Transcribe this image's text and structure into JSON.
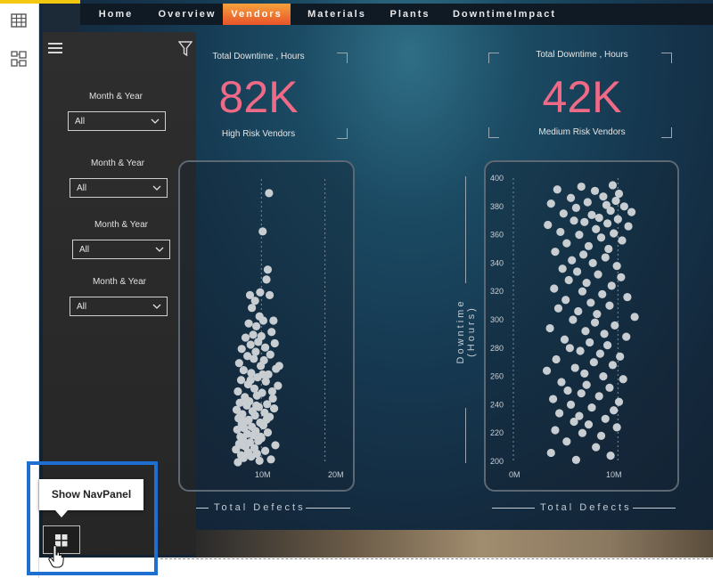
{
  "nav": {
    "tabs": [
      {
        "label": "Home",
        "active": false
      },
      {
        "label": "Overview",
        "active": false
      },
      {
        "label": "Vendors",
        "active": true
      },
      {
        "label": "Materials",
        "active": false
      },
      {
        "label": "Plants",
        "active": false
      },
      {
        "label": "DowntimeImpact",
        "active": false
      }
    ]
  },
  "filters": {
    "slicers": [
      {
        "label": "Month & Year",
        "value": "All"
      },
      {
        "label": "Month & Year",
        "value": "All"
      },
      {
        "label": "Month & Year",
        "value": "All"
      },
      {
        "label": "Month & Year",
        "value": "All"
      }
    ]
  },
  "kpis": {
    "high": {
      "title": "Total Downtime , Hours",
      "value": "82K",
      "caption": "High Risk Vendors"
    },
    "medium": {
      "title": "Total Downtime , Hours",
      "value": "42K",
      "caption": "Medium Risk Vendors"
    }
  },
  "tooltip": {
    "text": "Show NavPanel"
  },
  "colors": {
    "accent": "#ef6a86",
    "highlight": "#1f6fd0",
    "dot": "#c8cdd2"
  },
  "chart_data": [
    {
      "type": "scatter",
      "xlabel": "Total Defects",
      "ylabel": "",
      "x_ticks": [
        "10M",
        "20M"
      ],
      "y_ticks": [],
      "xlim": [
        0,
        23
      ],
      "ylim": [
        200,
        400
      ],
      "points": [
        [
          11.2,
          390
        ],
        [
          10.2,
          363
        ],
        [
          11.0,
          336
        ],
        [
          10.8,
          329
        ],
        [
          9.8,
          320
        ],
        [
          11.3,
          318
        ],
        [
          8.2,
          318
        ],
        [
          9.0,
          314
        ],
        [
          8.5,
          309
        ],
        [
          9.7,
          303
        ],
        [
          10.3,
          300
        ],
        [
          11.9,
          300
        ],
        [
          8.0,
          298
        ],
        [
          9.2,
          296
        ],
        [
          11.6,
          292
        ],
        [
          8.7,
          290
        ],
        [
          10.0,
          289
        ],
        [
          7.5,
          288
        ],
        [
          9.5,
          285
        ],
        [
          12.1,
          284
        ],
        [
          8.3,
          283
        ],
        [
          10.6,
          281
        ],
        [
          6.9,
          280
        ],
        [
          9.1,
          278
        ],
        [
          11.4,
          276
        ],
        [
          7.8,
          275
        ],
        [
          8.8,
          273
        ],
        [
          10.4,
          272
        ],
        [
          6.5,
          270
        ],
        [
          9.9,
          268
        ],
        [
          12.3,
          266
        ],
        [
          7.2,
          265
        ],
        [
          8.4,
          263
        ],
        [
          11.1,
          262
        ],
        [
          9.4,
          260
        ],
        [
          6.8,
          258
        ],
        [
          10.7,
          257
        ],
        [
          7.9,
          255
        ],
        [
          12.6,
          254
        ],
        [
          8.9,
          252
        ],
        [
          6.3,
          250
        ],
        [
          10.1,
          249
        ],
        [
          9.3,
          247
        ],
        [
          7.4,
          246
        ],
        [
          11.8,
          245
        ],
        [
          8.1,
          243
        ],
        [
          6.6,
          242
        ],
        [
          10.9,
          241
        ],
        [
          7.7,
          240
        ],
        [
          9.6,
          239
        ],
        [
          12.0,
          238
        ],
        [
          6.1,
          237
        ],
        [
          8.6,
          236
        ],
        [
          10.5,
          235
        ],
        [
          7.0,
          234
        ],
        [
          9.0,
          233
        ],
        [
          11.3,
          232
        ],
        [
          6.4,
          231
        ],
        [
          8.0,
          230
        ],
        [
          7.6,
          229
        ],
        [
          9.8,
          228
        ],
        [
          6.9,
          227
        ],
        [
          10.3,
          226
        ],
        [
          8.5,
          225
        ],
        [
          7.3,
          224
        ],
        [
          6.2,
          223
        ],
        [
          9.1,
          222
        ],
        [
          11.0,
          221
        ],
        [
          7.8,
          220
        ],
        [
          8.7,
          219
        ],
        [
          6.7,
          218
        ],
        [
          10.0,
          217
        ],
        [
          7.1,
          216
        ],
        [
          9.5,
          215
        ],
        [
          8.2,
          214
        ],
        [
          6.5,
          213
        ],
        [
          12.2,
          212
        ],
        [
          7.5,
          211
        ],
        [
          8.9,
          210
        ],
        [
          6.0,
          209
        ],
        [
          10.6,
          208
        ],
        [
          7.9,
          207
        ],
        [
          9.3,
          206
        ],
        [
          6.8,
          205
        ],
        [
          8.4,
          204
        ],
        [
          7.2,
          203
        ],
        [
          11.5,
          202
        ],
        [
          9.7,
          201
        ],
        [
          6.3,
          200
        ],
        [
          8.0,
          206
        ],
        [
          7.0,
          212
        ],
        [
          9.9,
          218
        ],
        [
          10.8,
          230
        ],
        [
          11.7,
          250
        ],
        [
          12.8,
          268
        ],
        [
          8.3,
          258
        ],
        [
          7.4,
          244
        ],
        [
          6.6,
          232
        ],
        [
          9.2,
          240
        ],
        [
          10.2,
          262
        ]
      ]
    },
    {
      "type": "scatter",
      "xlabel": "Total Defects",
      "ylabel": "Downtime (Hours)",
      "x_ticks": [
        "0M",
        "10M"
      ],
      "y_ticks": [
        200,
        220,
        240,
        260,
        280,
        300,
        320,
        340,
        360,
        380,
        400
      ],
      "xlim": [
        0,
        15
      ],
      "ylim": [
        200,
        400
      ],
      "points": [
        [
          4.2,
          392
        ],
        [
          6.5,
          394
        ],
        [
          9.5,
          395
        ],
        [
          7.8,
          391
        ],
        [
          10.1,
          389
        ],
        [
          8.6,
          387
        ],
        [
          5.5,
          386
        ],
        [
          9.8,
          384
        ],
        [
          7.1,
          383
        ],
        [
          3.6,
          382
        ],
        [
          8.9,
          381
        ],
        [
          10.6,
          380
        ],
        [
          6.0,
          379
        ],
        [
          9.3,
          377
        ],
        [
          11.3,
          376
        ],
        [
          4.8,
          375
        ],
        [
          7.5,
          374
        ],
        [
          8.2,
          372
        ],
        [
          10.0,
          371
        ],
        [
          5.8,
          370
        ],
        [
          6.8,
          369
        ],
        [
          9.0,
          368
        ],
        [
          3.3,
          367
        ],
        [
          11.0,
          366
        ],
        [
          7.9,
          364
        ],
        [
          4.5,
          362
        ],
        [
          9.6,
          361
        ],
        [
          6.3,
          360
        ],
        [
          8.4,
          358
        ],
        [
          10.4,
          356
        ],
        [
          5.1,
          354
        ],
        [
          7.2,
          352
        ],
        [
          9.1,
          350
        ],
        [
          4.0,
          348
        ],
        [
          6.7,
          346
        ],
        [
          8.8,
          344
        ],
        [
          5.6,
          342
        ],
        [
          7.6,
          340
        ],
        [
          9.9,
          338
        ],
        [
          4.7,
          336
        ],
        [
          6.1,
          334
        ],
        [
          8.1,
          332
        ],
        [
          10.3,
          330
        ],
        [
          5.3,
          328
        ],
        [
          7.0,
          326
        ],
        [
          9.4,
          324
        ],
        [
          3.9,
          322
        ],
        [
          6.6,
          320
        ],
        [
          8.5,
          318
        ],
        [
          10.9,
          316
        ],
        [
          5.0,
          314
        ],
        [
          7.4,
          312
        ],
        [
          9.2,
          310
        ],
        [
          4.3,
          308
        ],
        [
          6.2,
          306
        ],
        [
          8.0,
          304
        ],
        [
          11.6,
          302
        ],
        [
          5.7,
          300
        ],
        [
          7.8,
          298
        ],
        [
          9.7,
          296
        ],
        [
          3.5,
          294
        ],
        [
          6.9,
          292
        ],
        [
          8.7,
          290
        ],
        [
          10.8,
          288
        ],
        [
          4.9,
          286
        ],
        [
          7.3,
          284
        ],
        [
          9.0,
          282
        ],
        [
          5.4,
          280
        ],
        [
          6.4,
          278
        ],
        [
          8.3,
          276
        ],
        [
          10.2,
          274
        ],
        [
          4.1,
          272
        ],
        [
          7.7,
          270
        ],
        [
          9.5,
          268
        ],
        [
          5.9,
          266
        ],
        [
          3.2,
          264
        ],
        [
          6.8,
          262
        ],
        [
          8.6,
          260
        ],
        [
          10.5,
          258
        ],
        [
          4.6,
          256
        ],
        [
          7.0,
          254
        ],
        [
          9.2,
          252
        ],
        [
          5.2,
          250
        ],
        [
          6.5,
          248
        ],
        [
          8.2,
          246
        ],
        [
          3.8,
          244
        ],
        [
          10.1,
          242
        ],
        [
          5.5,
          240
        ],
        [
          7.5,
          238
        ],
        [
          9.6,
          236
        ],
        [
          4.4,
          234
        ],
        [
          6.3,
          232
        ],
        [
          8.8,
          230
        ],
        [
          5.8,
          228
        ],
        [
          7.2,
          226
        ],
        [
          9.9,
          224
        ],
        [
          4.0,
          222
        ],
        [
          6.6,
          220
        ],
        [
          8.4,
          218
        ],
        [
          5.1,
          214
        ],
        [
          7.9,
          210
        ],
        [
          3.6,
          206
        ],
        [
          9.3,
          204
        ],
        [
          6.0,
          201
        ]
      ]
    }
  ]
}
